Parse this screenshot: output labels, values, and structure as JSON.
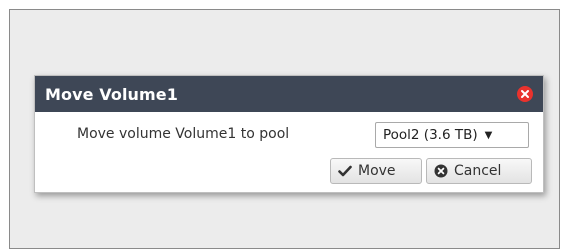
{
  "dialog": {
    "title": "Move Volume1",
    "prompt_label": "Move volume Volume1 to pool",
    "pool_select": {
      "selected": "Pool2 (3.6 TB)"
    },
    "buttons": {
      "move_label": "Move",
      "cancel_label": "Cancel"
    }
  },
  "colors": {
    "titlebar": "#3e4756",
    "close": "#e9322d"
  },
  "icons": {
    "close": "close-circle-icon",
    "move": "checkmark-icon",
    "cancel": "cancel-circle-icon",
    "select_arrow": "caret-down-icon"
  }
}
